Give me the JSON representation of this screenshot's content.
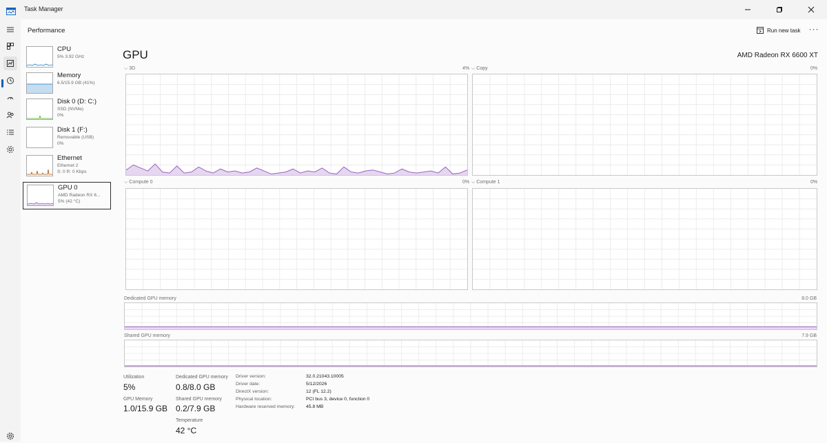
{
  "window": {
    "title": "Task Manager"
  },
  "header": {
    "page_title": "Performance",
    "run_new_task": "Run new task",
    "more": "···"
  },
  "nav": [
    "hamburger-menu-icon",
    "processes-icon",
    "performance-icon",
    "app-history-icon",
    "startup-apps-icon",
    "users-icon",
    "details-icon",
    "services-icon",
    "settings-icon"
  ],
  "devices": [
    {
      "name": "CPU",
      "sub1": "5% 3.92 GHz",
      "sub2": ""
    },
    {
      "name": "Memory",
      "sub1": "6.5/15.9 GB (41%)",
      "sub2": ""
    },
    {
      "name": "Disk 0 (D: C:)",
      "sub1": "SSD (NVMe)",
      "sub2": "0%"
    },
    {
      "name": "Disk 1 (F:)",
      "sub1": "Removable (USB)",
      "sub2": "0%"
    },
    {
      "name": "Ethernet",
      "sub1": "Ethernet 2",
      "sub2": "S: 0 R: 0 Kbps"
    },
    {
      "name": "GPU 0",
      "sub1": "AMD Radeon RX 6...",
      "sub2": "5% (42 °C)"
    }
  ],
  "gpu": {
    "title": "GPU",
    "model": "AMD Radeon RX 6600 XT",
    "engines": [
      {
        "name": "3D",
        "pct": "4%"
      },
      {
        "name": "Copy",
        "pct": "0%"
      },
      {
        "name": "Compute 0",
        "pct": "0%"
      },
      {
        "name": "Compute 1",
        "pct": "0%"
      }
    ],
    "dedicated_label": "Dedicated GPU memory",
    "dedicated_max": "8.0 GB",
    "shared_label": "Shared GPU memory",
    "shared_max": "7.9 GB",
    "engine_3d_series": [
      5,
      10,
      7,
      4,
      11,
      3,
      2,
      9,
      2,
      3,
      8,
      4,
      2,
      6,
      3,
      4,
      2,
      3,
      7,
      4,
      1,
      2,
      3,
      6,
      2,
      4,
      3,
      7,
      2,
      1,
      8,
      3,
      2,
      4,
      5,
      3,
      1,
      2,
      6,
      3,
      2,
      3,
      4,
      2,
      8,
      1,
      2,
      5
    ]
  },
  "stats": {
    "utilization_label": "Utilization",
    "utilization": "5%",
    "gpu_memory_label": "GPU Memory",
    "gpu_memory": "1.0/15.9 GB",
    "dedicated_label": "Dedicated GPU memory",
    "dedicated": "0.8/8.0 GB",
    "shared_label": "Shared GPU memory",
    "shared": "0.2/7.9 GB",
    "temperature_label": "Temperature",
    "temperature": "42 °C"
  },
  "details": [
    {
      "k": "Driver version:",
      "v": "32.0.21043.10005"
    },
    {
      "k": "Driver date:",
      "v": "5/12/2026"
    },
    {
      "k": "DirectX version:",
      "v": "12 (FL 12.2)"
    },
    {
      "k": "Physical location:",
      "v": "PCI bus 3, device 0, function 0"
    },
    {
      "k": "Hardware reserved memory:",
      "v": "45.8 MB"
    }
  ],
  "colors": {
    "gpu_line": "#9b5fc0",
    "gpu_fill": "#e6d7f1",
    "cpu_line": "#117dbb",
    "mem_fill": "#c6dcf1",
    "disk_line": "#4da60c",
    "eth_line": "#a74f01"
  }
}
